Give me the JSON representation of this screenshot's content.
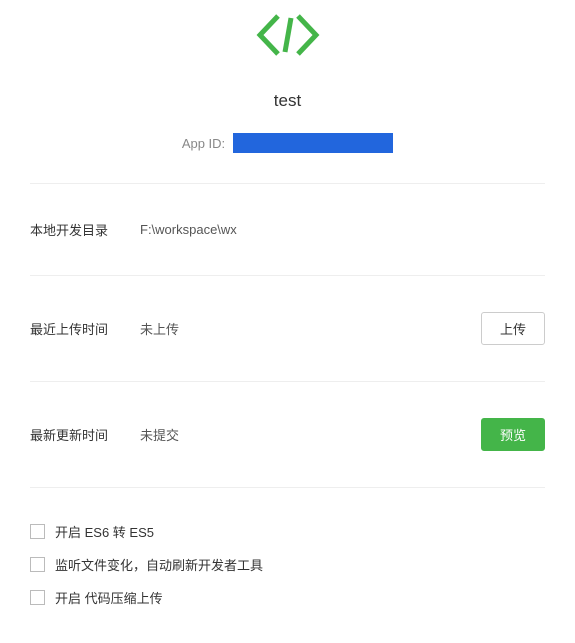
{
  "header": {
    "app_name": "test",
    "app_id_label": "App ID:",
    "app_id_value": ""
  },
  "rows": {
    "dir_label": "本地开发目录",
    "dir_value": "F:\\workspace\\wx",
    "upload_time_label": "最近上传时间",
    "upload_time_value": "未上传",
    "upload_button": "上传",
    "update_time_label": "最新更新时间",
    "update_time_value": "未提交",
    "preview_button": "预览"
  },
  "options": {
    "opt1": "开启 ES6 转 ES5",
    "opt2": "监听文件变化，自动刷新开发者工具",
    "opt3": "开启 代码压缩上传"
  },
  "colors": {
    "accent_green": "#44b549",
    "app_id_bg": "#2266dd"
  }
}
